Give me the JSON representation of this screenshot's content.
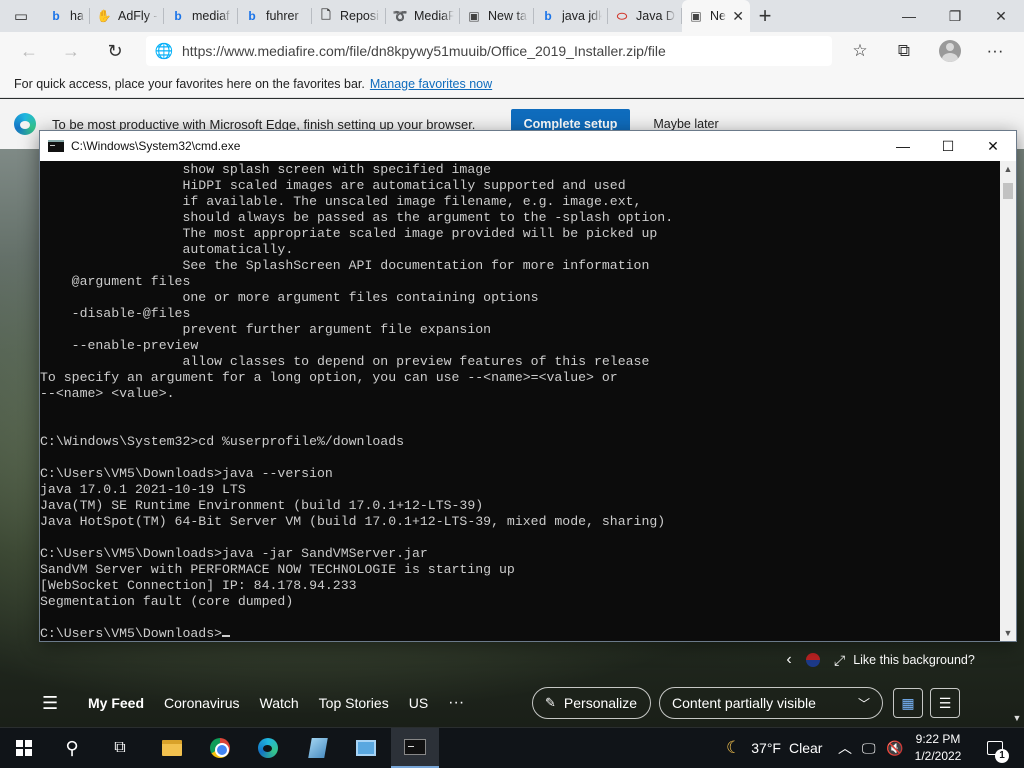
{
  "browser": {
    "tabs": [
      {
        "title": "happy r",
        "icon": "bing-icon",
        "icon_glyph": "b",
        "icon_color": "#1a73e8"
      },
      {
        "title": "AdFly -",
        "icon": "adfly-icon",
        "icon_glyph": "✋",
        "icon_color": "#e8a33d"
      },
      {
        "title": "mediaf",
        "icon": "bing-icon",
        "icon_glyph": "b",
        "icon_color": "#1a73e8"
      },
      {
        "title": "fuhrer",
        "icon": "bing-icon",
        "icon_glyph": "b",
        "icon_color": "#1a73e8"
      },
      {
        "title": "Reposi",
        "icon": "page-icon",
        "icon_glyph": "🗋",
        "icon_color": "#444444"
      },
      {
        "title": "MediaF",
        "icon": "mediafire-icon",
        "icon_glyph": "➰",
        "icon_color": "#1e6fd9"
      },
      {
        "title": "New ta",
        "icon": "newtab-icon",
        "icon_glyph": "▣",
        "icon_color": "#444444"
      },
      {
        "title": "java jdk",
        "icon": "bing-icon",
        "icon_glyph": "b",
        "icon_color": "#1a73e8"
      },
      {
        "title": "Java D",
        "icon": "oracle-icon",
        "icon_glyph": "⬭",
        "icon_color": "#d23b2f"
      },
      {
        "title": "Ne",
        "icon": "newtab-icon",
        "icon_glyph": "▣",
        "icon_color": "#444444",
        "active": true
      }
    ],
    "url": "https://www.mediafire.com/file/dn8kpywy51muuib/Office_2019_Installer.zip/file",
    "favorites_bar": {
      "text": "For quick access, place your favorites here on the favorites bar.",
      "link": "Manage favorites now"
    },
    "setup_banner": {
      "text": "To be most productive with Microsoft Edge, finish setting up your browser.",
      "primary_button": "Complete setup",
      "secondary_button": "Maybe later"
    }
  },
  "cmd_window": {
    "title": "C:\\Windows\\System32\\cmd.exe",
    "lines": [
      "                  show splash screen with specified image",
      "                  HiDPI scaled images are automatically supported and used",
      "                  if available. The unscaled image filename, e.g. image.ext,",
      "                  should always be passed as the argument to the -splash option.",
      "                  The most appropriate scaled image provided will be picked up",
      "                  automatically.",
      "                  See the SplashScreen API documentation for more information",
      "    @argument files",
      "                  one or more argument files containing options",
      "    -disable-@files",
      "                  prevent further argument file expansion",
      "    --enable-preview",
      "                  allow classes to depend on preview features of this release",
      "To specify an argument for a long option, you can use --<name>=<value> or",
      "--<name> <value>.",
      "",
      "",
      "C:\\Windows\\System32>cd %userprofile%/downloads",
      "",
      "C:\\Users\\VM5\\Downloads>java --version",
      "java 17.0.1 2021-10-19 LTS",
      "Java(TM) SE Runtime Environment (build 17.0.1+12-LTS-39)",
      "Java HotSpot(TM) 64-Bit Server VM (build 17.0.1+12-LTS-39, mixed mode, sharing)",
      "",
      "C:\\Users\\VM5\\Downloads>java -jar SandVMServer.jar",
      "SandVM Server with PERFORMACE NOW TECHNOLOGIE is starting up",
      "[WebSocket Connection] IP: 84.178.94.233",
      "Segmentation fault (core dumped)",
      "",
      "C:\\Users\\VM5\\Downloads>"
    ]
  },
  "background": {
    "like_text": "Like this background?"
  },
  "feed": {
    "items": [
      "My Feed",
      "Coronavirus",
      "Watch",
      "Top Stories",
      "US"
    ],
    "more": "···",
    "personalize": "Personalize",
    "content_select": "Content partially visible"
  },
  "taskbar": {
    "weather_temp": "37°F",
    "weather_condition": "Clear",
    "time": "9:22 PM",
    "date": "1/2/2022",
    "notification_count": "1"
  }
}
